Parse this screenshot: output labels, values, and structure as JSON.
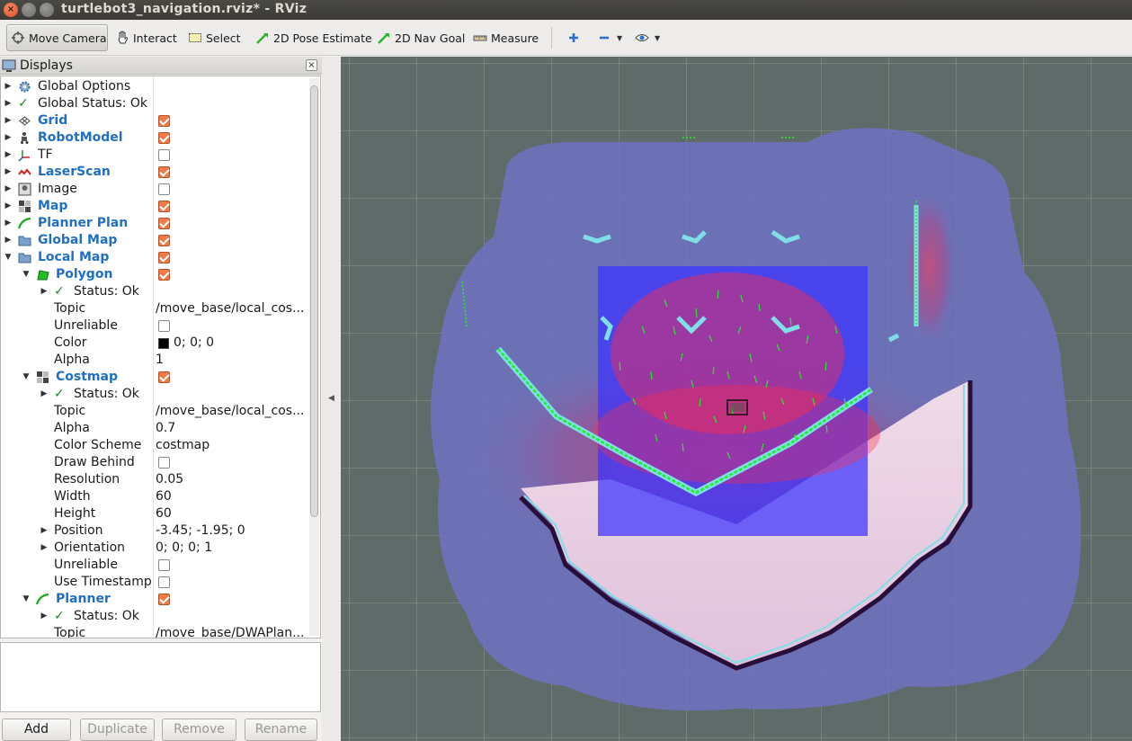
{
  "window": {
    "title": "turtlebot3_navigation.rviz* - RViz"
  },
  "toolbar": {
    "tools": [
      {
        "label": "Move Camera",
        "icon": "move-camera-icon",
        "active": true
      },
      {
        "label": "Interact",
        "icon": "hand-icon"
      },
      {
        "label": "Select",
        "icon": "select-box-icon"
      },
      {
        "label": "2D Pose Estimate",
        "icon": "green-arrow-icon"
      },
      {
        "label": "2D Nav Goal",
        "icon": "green-arrow-icon"
      },
      {
        "label": "Measure",
        "icon": "ruler-icon"
      }
    ]
  },
  "displays": {
    "title": "Displays",
    "rows": [
      {
        "label": "Global Options"
      },
      {
        "label": "Global Status: Ok"
      },
      {
        "label": "Grid",
        "checked": true
      },
      {
        "label": "RobotModel",
        "checked": true
      },
      {
        "label": "TF",
        "checked": false
      },
      {
        "label": "LaserScan",
        "checked": true
      },
      {
        "label": "Image",
        "checked": false
      },
      {
        "label": "Map",
        "checked": true
      },
      {
        "label": "Planner Plan",
        "checked": true
      },
      {
        "label": "Global Map",
        "checked": true
      },
      {
        "label": "Local Map",
        "checked": true
      },
      {
        "label": "Polygon",
        "checked": true
      },
      {
        "label": "Status: Ok"
      },
      {
        "label": "Topic",
        "value": "/move_base/local_cos..."
      },
      {
        "label": "Unreliable",
        "checked": false
      },
      {
        "label": "Color",
        "value": "0; 0; 0"
      },
      {
        "label": "Alpha",
        "value": "1"
      },
      {
        "label": "Costmap",
        "checked": true
      },
      {
        "label": "Status: Ok"
      },
      {
        "label": "Topic",
        "value": "/move_base/local_cos..."
      },
      {
        "label": "Alpha",
        "value": "0.7"
      },
      {
        "label": "Color Scheme",
        "value": "costmap"
      },
      {
        "label": "Draw Behind",
        "checked": false
      },
      {
        "label": "Resolution",
        "value": "0.05"
      },
      {
        "label": "Width",
        "value": "60"
      },
      {
        "label": "Height",
        "value": "60"
      },
      {
        "label": "Position",
        "value": "-3.45; -1.95; 0"
      },
      {
        "label": "Orientation",
        "value": "0; 0; 0; 1"
      },
      {
        "label": "Unreliable",
        "checked": false
      },
      {
        "label": "Use Timestamp",
        "checked": false
      },
      {
        "label": "Planner",
        "checked": true
      },
      {
        "label": "Status: Ok"
      },
      {
        "label": "Topic",
        "value": "/move_base/DWAPlan..."
      }
    ],
    "buttons": {
      "add": "Add",
      "duplicate": "Duplicate",
      "remove": "Remove",
      "rename": "Rename"
    }
  },
  "colors": {
    "costmap_overlay": "#3c33ff",
    "global_map_fill": "#6f72c4",
    "laser": "#22ee22",
    "wall": "#2a0e3a"
  }
}
